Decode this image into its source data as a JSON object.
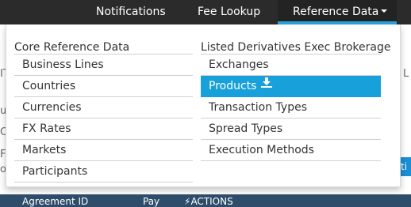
{
  "topnav": {
    "items": [
      {
        "label": "Notifications"
      },
      {
        "label": "Fee Lookup"
      },
      {
        "label": "Reference Data"
      }
    ]
  },
  "dropdown": {
    "left_column": {
      "heading": "Core Reference Data",
      "items": [
        {
          "label": "Business Lines"
        },
        {
          "label": "Countries"
        },
        {
          "label": "Currencies"
        },
        {
          "label": "FX Rates"
        },
        {
          "label": "Markets"
        },
        {
          "label": "Participants"
        }
      ]
    },
    "right_column": {
      "heading": "Listed Derivatives Exec Brokerage",
      "items": [
        {
          "label": "Exchanges"
        },
        {
          "label": "Products",
          "icon": "download-icon",
          "highlighted": true
        },
        {
          "label": "Transaction Types"
        },
        {
          "label": "Spread Types"
        },
        {
          "label": "Execution Methods"
        }
      ]
    }
  },
  "background": {
    "fragments": [
      "IT",
      "L",
      "u",
      "C",
      "FL",
      "o"
    ],
    "blue_button_label": "ti",
    "table_header": {
      "agreement_id": "Agreement ID",
      "pay": "Pay",
      "actions": "ACTIONS"
    }
  },
  "colors": {
    "topbar": "#2b2b2b",
    "accent": "#29a3dc",
    "highlight": "#18a0db",
    "table_header": "#2e4d6b"
  }
}
